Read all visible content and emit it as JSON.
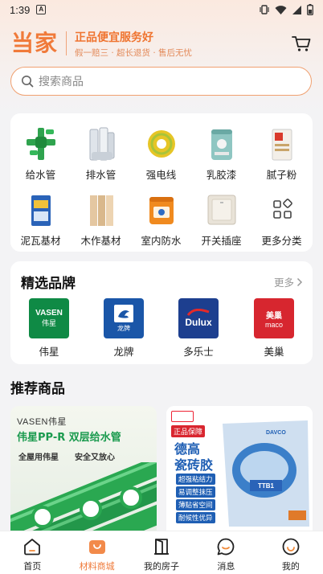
{
  "status_bar": {
    "time": "1:39",
    "badge": "A"
  },
  "header": {
    "logo": "当家",
    "slogan_main": "正品便宜服务好",
    "slogan_sub": "假一赔三 · 超长退货 · 售后无忧"
  },
  "search": {
    "placeholder": "搜索商品"
  },
  "categories": [
    {
      "label": "给水管",
      "icon": "green-pipe-fittings"
    },
    {
      "label": "排水管",
      "icon": "white-pvc-pipes"
    },
    {
      "label": "强电线",
      "icon": "yellow-wire-coil"
    },
    {
      "label": "乳胶漆",
      "icon": "paint-bucket"
    },
    {
      "label": "腻子粉",
      "icon": "putty-bag"
    },
    {
      "label": "泥瓦基材",
      "icon": "tile-adhesive-box"
    },
    {
      "label": "木作基材",
      "icon": "wood-boards"
    },
    {
      "label": "室内防水",
      "icon": "waterproof-bucket"
    },
    {
      "label": "开关插座",
      "icon": "wall-switch"
    },
    {
      "label": "更多分类",
      "icon": "grid-more-icon"
    }
  ],
  "brands": {
    "title": "精选品牌",
    "more": "更多",
    "items": [
      {
        "name": "伟星",
        "logo_text": "VASEN",
        "logo_sub": "伟星",
        "color": "#0f8a45"
      },
      {
        "name": "龙牌",
        "logo_text": "龙牌",
        "color": "#1a56a8"
      },
      {
        "name": "多乐士",
        "logo_text": "Dulux",
        "color": "#1d3f8f"
      },
      {
        "name": "美巢",
        "logo_text": "美巢",
        "logo_sub": "maco",
        "color": "#d7262f"
      }
    ]
  },
  "recommend": {
    "title": "推荐商品",
    "card1": {
      "brand": "VASEN伟星",
      "headline": "伟星PP-R 双层给水管",
      "tag1": "全屋用伟星",
      "tag2": "安全又放心"
    },
    "card2": {
      "badge": "正品保障",
      "headline1": "德高",
      "headline2": "瓷砖胶",
      "features": [
        "超强粘结力",
        "易调整抹压",
        "薄贴省空间",
        "耐候性优异"
      ],
      "bag_brand": "DAVCO",
      "bag_code": "TTB1"
    }
  },
  "tabbar": [
    {
      "label": "首页",
      "active": false
    },
    {
      "label": "材料商城",
      "active": true
    },
    {
      "label": "我的房子",
      "active": false
    },
    {
      "label": "消息",
      "active": false
    },
    {
      "label": "我的",
      "active": false
    }
  ],
  "colors": {
    "accent": "#ef7a3a",
    "brand_green": "#1a9a4e",
    "tabbar_active": "#ef7a3a"
  }
}
